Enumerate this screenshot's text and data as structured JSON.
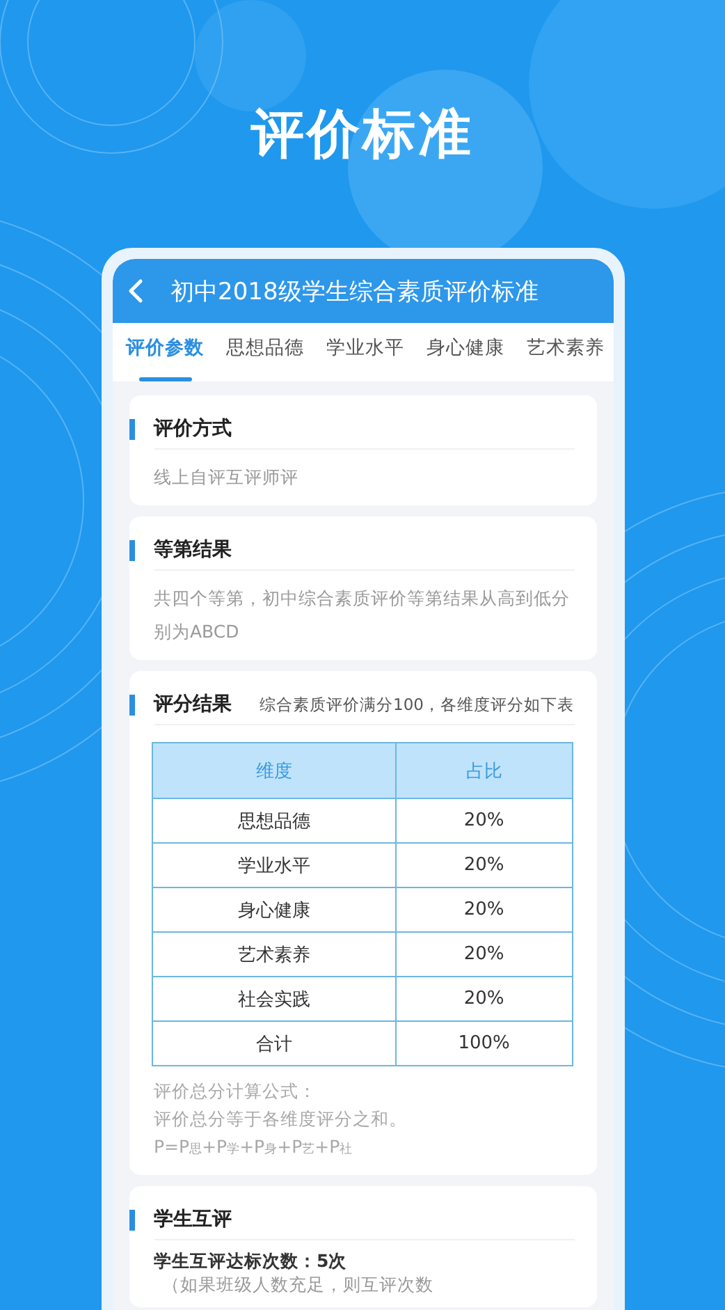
{
  "title": "评价标准",
  "header": {
    "title": "初中2018级学生综合素质评价标准"
  },
  "tabs": [
    {
      "label": "评价参数",
      "selected": true
    },
    {
      "label": "思想品德",
      "selected": false
    },
    {
      "label": "学业水平",
      "selected": false
    },
    {
      "label": "身心健康",
      "selected": false
    },
    {
      "label": "艺术素养",
      "selected": false
    }
  ],
  "sections": [
    {
      "kind": "text",
      "title": "评价方式",
      "body": "线上自评互评师评"
    },
    {
      "kind": "text",
      "title": "等第结果",
      "body": "共四个等第，初中综合素质评价等第结果从高到低分别为ABCD"
    },
    {
      "kind": "table",
      "title": "评分结果",
      "note": "综合素质评价满分100，各维度评分如下表",
      "table": {
        "columns": [
          "维度",
          "占比"
        ],
        "rows": [
          [
            "思想品德",
            "20%"
          ],
          [
            "学业水平",
            "20%"
          ],
          [
            "身心健康",
            "20%"
          ],
          [
            "艺术素养",
            "20%"
          ],
          [
            "社会实践",
            "20%"
          ],
          [
            "合计",
            "100%"
          ]
        ]
      },
      "formula": [
        "评价总分计算公式：",
        "评价总分等于各维度评分之和。",
        "P=P$_{思}$+P$_{学}$+P$_{身}$+P$_{艺}$+P$_{社}$"
      ]
    },
    {
      "kind": "count",
      "title": "学生互评",
      "count": "学生互评达标次数：5次",
      "body": "（如果班级人数充足，则互评次数"
    }
  ]
}
